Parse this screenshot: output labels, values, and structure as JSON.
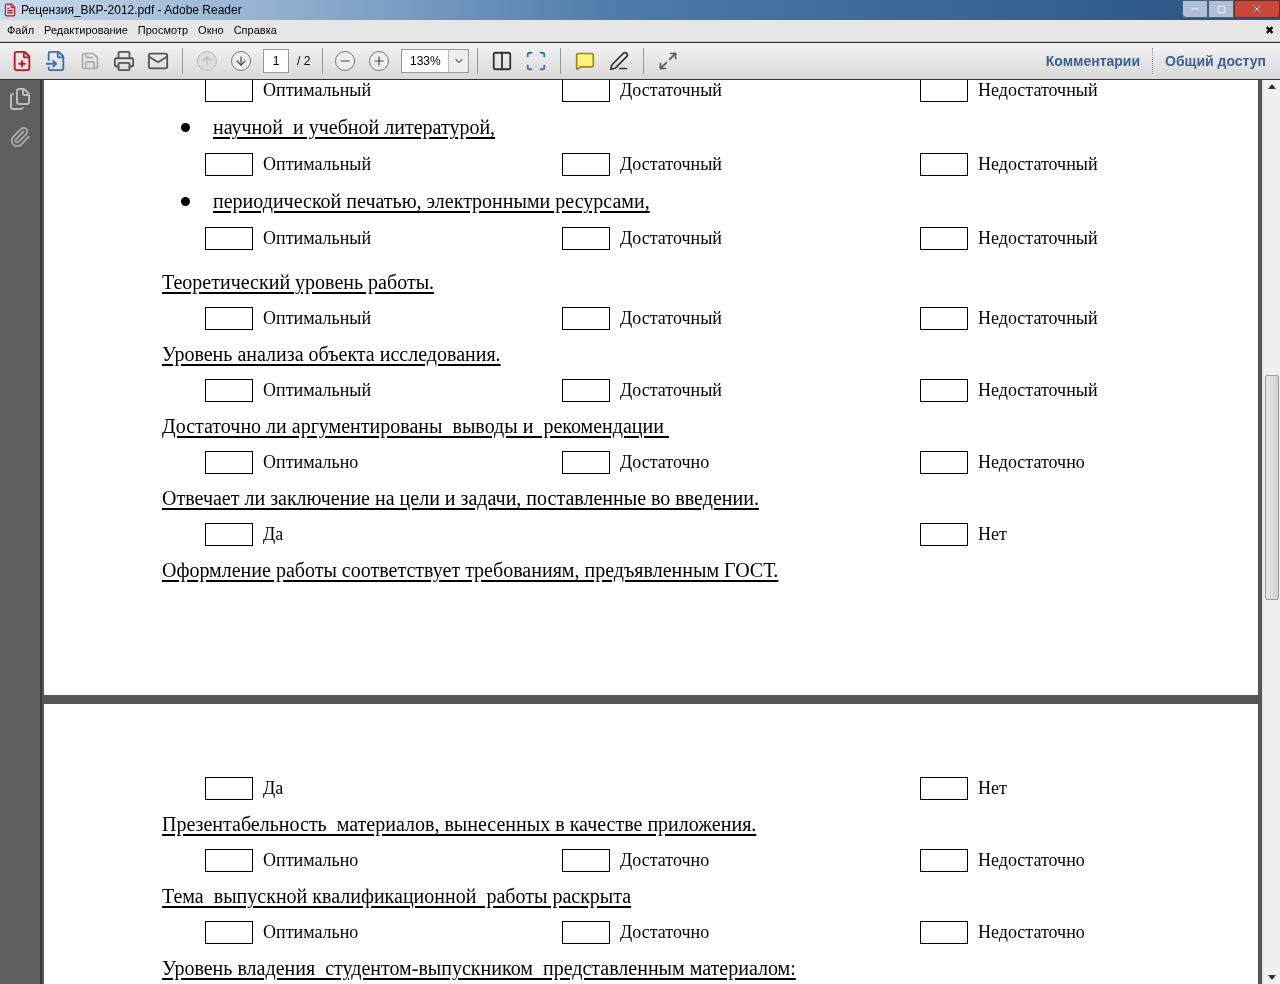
{
  "window": {
    "title": "Рецензия_ВКР-2012.pdf - Adobe Reader"
  },
  "menu": [
    "Файл",
    "Редактирование",
    "Просмотр",
    "Окно",
    "Справка"
  ],
  "menu_close": "✖",
  "toolbar": {
    "page": "1",
    "page_total": "/ 2",
    "zoom": "133%",
    "links": [
      "Комментарии",
      "Общий доступ"
    ]
  },
  "pages": [
    {
      "rows": [
        {
          "kind": "choice3",
          "options": [
            {
              "label": "Оптимальный",
              "checked": false
            },
            {
              "label": "Достаточный",
              "checked": false
            },
            {
              "label": "Недостаточный",
              "checked": false
            }
          ]
        },
        {
          "kind": "bullet",
          "text": "научной  и учебной литературой,"
        },
        {
          "kind": "choice3",
          "options": [
            {
              "label": "Оптимальный",
              "checked": false
            },
            {
              "label": "Достаточный",
              "checked": false
            },
            {
              "label": "Недостаточный",
              "checked": false
            }
          ]
        },
        {
          "kind": "bullet",
          "text": "периодической печатью, электронными ресурсами,"
        },
        {
          "kind": "choice3",
          "options": [
            {
              "label": "Оптимальный",
              "checked": false
            },
            {
              "label": "Достаточный",
              "checked": false
            },
            {
              "label": "Недостаточный",
              "checked": false
            }
          ]
        },
        {
          "kind": "heading",
          "text": "Теоретический уровень работы."
        },
        {
          "kind": "choice3",
          "options": [
            {
              "label": "Оптимальный",
              "checked": false
            },
            {
              "label": "Достаточный",
              "checked": false
            },
            {
              "label": "Недостаточный",
              "checked": false
            }
          ]
        },
        {
          "kind": "heading",
          "text": "Уровень анализа объекта исследования."
        },
        {
          "kind": "choice3",
          "options": [
            {
              "label": "Оптимальный",
              "checked": false
            },
            {
              "label": "Достаточный",
              "checked": false
            },
            {
              "label": "Недостаточный",
              "checked": false
            }
          ]
        },
        {
          "kind": "heading",
          "text": "Достаточно ли аргументированы  выводы и  рекомендации "
        },
        {
          "kind": "choice3",
          "options": [
            {
              "label": "Оптимально",
              "checked": false
            },
            {
              "label": "Достаточно",
              "checked": false
            },
            {
              "label": "Недостаточно",
              "checked": false
            }
          ]
        },
        {
          "kind": "heading",
          "text": "Отвечает ли заключение на цели и задачи, поставленные во введении."
        },
        {
          "kind": "choice2",
          "options": [
            {
              "label": "Да",
              "checked": false
            },
            {
              "label": "Нет",
              "checked": false
            }
          ]
        },
        {
          "kind": "heading",
          "text": "Оформление работы соответствует требованиям, предъявленным ГОСТ."
        }
      ]
    },
    {
      "rows": [
        {
          "kind": "choice2",
          "options": [
            {
              "label": "Да",
              "checked": false
            },
            {
              "label": "Нет",
              "checked": false
            }
          ]
        },
        {
          "kind": "heading",
          "text": "Презентабельность  материалов, вынесенных в качестве приложения."
        },
        {
          "kind": "choice3",
          "options": [
            {
              "label": "Оптимально",
              "checked": false
            },
            {
              "label": "Достаточно",
              "checked": false
            },
            {
              "label": "Недостаточно",
              "checked": false
            }
          ]
        },
        {
          "kind": "heading",
          "text": "Тема  выпускной квалификационной  работы раскрыта"
        },
        {
          "kind": "choice3",
          "options": [
            {
              "label": "Оптимально",
              "checked": false
            },
            {
              "label": "Достаточно",
              "checked": false
            },
            {
              "label": "Недостаточно",
              "checked": false
            }
          ]
        },
        {
          "kind": "heading",
          "text": "Уровень владения  студентом-выпускником  представленным материалом:"
        }
      ]
    }
  ]
}
